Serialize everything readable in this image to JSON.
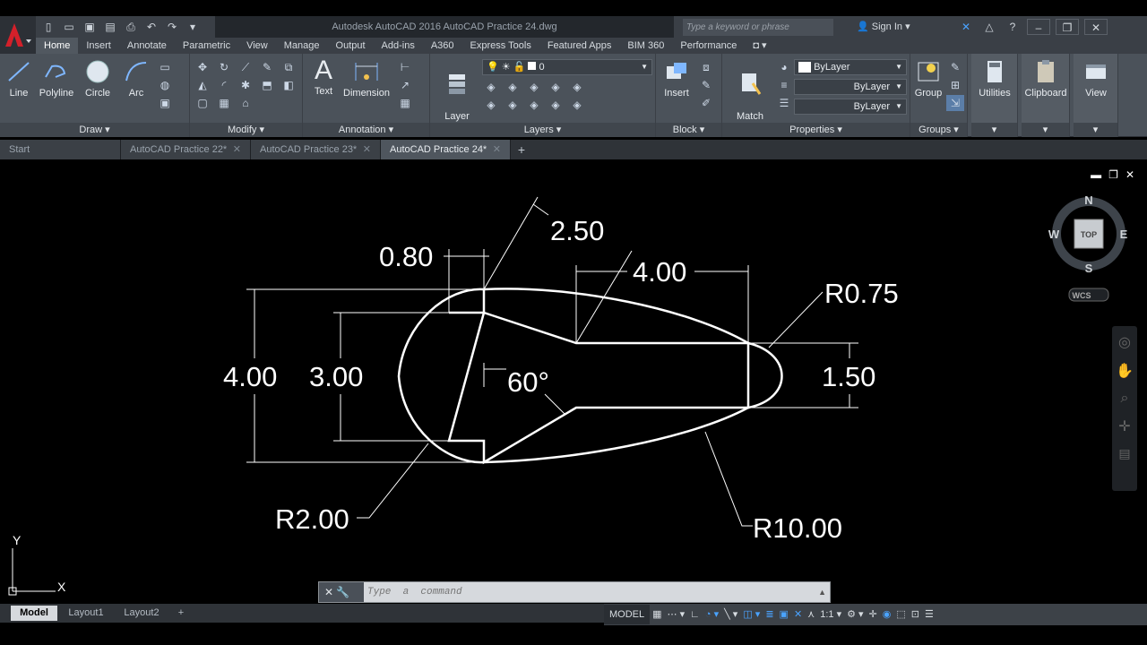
{
  "titlebar": {
    "title": "Autodesk AutoCAD 2016    AutoCAD Practice 24.dwg",
    "search_placeholder": "Type a keyword or phrase",
    "sign_in": "Sign In"
  },
  "ribbon_tabs": [
    "Home",
    "Insert",
    "Annotate",
    "Parametric",
    "View",
    "Manage",
    "Output",
    "Add-ins",
    "A360",
    "Express Tools",
    "Featured Apps",
    "BIM 360",
    "Performance"
  ],
  "ribbon": {
    "draw": {
      "label": "Draw",
      "line": "Line",
      "polyline": "Polyline",
      "circle": "Circle",
      "arc": "Arc"
    },
    "modify": {
      "label": "Modify"
    },
    "annotation": {
      "label": "Annotation",
      "text": "Text",
      "dimension": "Dimension"
    },
    "layers": {
      "label": "Layers",
      "layer_properties": "Layer\nProperties",
      "current_layer": "0"
    },
    "block": {
      "label": "Block",
      "insert": "Insert"
    },
    "properties": {
      "label": "Properties",
      "match_properties": "Match\nProperties",
      "color": "ByLayer",
      "linetype": "ByLayer",
      "lineweight": "ByLayer"
    },
    "groups": {
      "label": "Groups",
      "group": "Group"
    },
    "utilities": "Utilities",
    "clipboard": "Clipboard",
    "view": "View"
  },
  "file_tabs": [
    {
      "label": "Start"
    },
    {
      "label": "AutoCAD Practice 22*"
    },
    {
      "label": "AutoCAD Practice 23*"
    },
    {
      "label": "AutoCAD Practice 24*"
    }
  ],
  "viewcube": {
    "n": "N",
    "s": "S",
    "e": "E",
    "w": "W",
    "top": "TOP",
    "wcs": "WCS"
  },
  "ucs": {
    "x": "X",
    "y": "Y"
  },
  "drawing": {
    "dims": {
      "d080": "0.80",
      "d250": "2.50",
      "d400_top": "4.00",
      "r075": "R0.75",
      "d400_left": "4.00",
      "d300": "3.00",
      "a60": "60°",
      "d150": "1.50",
      "r200": "R2.00",
      "r1000": "R10.00"
    }
  },
  "command": {
    "placeholder": "Type  a  command"
  },
  "layout_tabs": [
    "Model",
    "Layout1",
    "Layout2"
  ],
  "status": {
    "model": "MODEL",
    "scale": "1:1"
  }
}
